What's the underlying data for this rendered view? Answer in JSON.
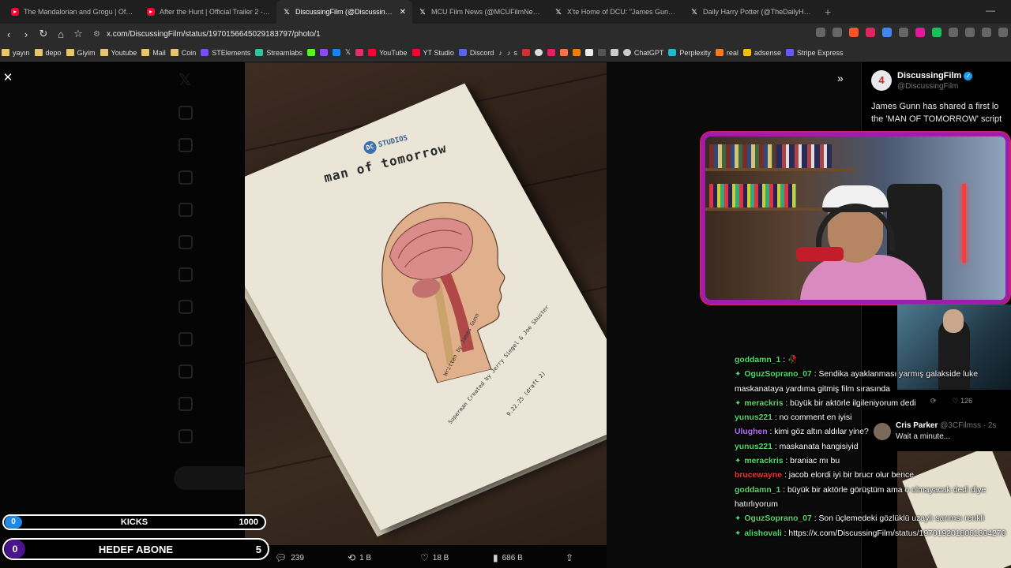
{
  "browser": {
    "tabs": [
      {
        "favicon": "youtube-icon",
        "label": "The Mandalorian and Grogu | Officia",
        "active": false
      },
      {
        "favicon": "youtube-icon",
        "label": "After the Hunt | Official Trailer 2 - Yo",
        "active": false
      },
      {
        "favicon": "x-icon",
        "label": "DiscussingFilm (@DiscussingFilm",
        "active": true
      },
      {
        "favicon": "x-icon",
        "label": "MCU Film News (@MCUFilmNews) /",
        "active": false
      },
      {
        "favicon": "x-icon",
        "label": "X'te Home of DCU: \"James Gunn say",
        "active": false
      },
      {
        "favicon": "x-icon",
        "label": "Daily Harry Potter (@TheDailyHPotte",
        "active": false
      }
    ],
    "url": "x.com/DiscussingFilm/status/1970156645029183797/photo/1",
    "bookmarks": [
      {
        "label": "yayın",
        "type": "folder"
      },
      {
        "label": "depo",
        "type": "folder"
      },
      {
        "label": "Giyim",
        "type": "folder"
      },
      {
        "label": "Youtube",
        "type": "folder"
      },
      {
        "label": "Mail",
        "type": "folder"
      },
      {
        "label": "Coin",
        "type": "folder"
      },
      {
        "label": "STElements",
        "type": "site",
        "color": "#7b4dff"
      },
      {
        "label": "Streamlabs",
        "type": "site",
        "color": "#31c3a2"
      },
      {
        "label": "YouTube",
        "type": "site",
        "color": "#ff0033"
      },
      {
        "label": "YT Studio",
        "type": "site",
        "color": "#ff0033"
      },
      {
        "label": "Discord",
        "type": "site",
        "color": "#5865f2"
      },
      {
        "label": "s",
        "type": "site",
        "color": "#222222"
      },
      {
        "label": "ChatGPT",
        "type": "site",
        "color": "#cccccc"
      },
      {
        "label": "Perplexity",
        "type": "site",
        "color": "#20b8cd"
      },
      {
        "label": "real",
        "type": "site",
        "color": "#ff7a1a"
      },
      {
        "label": "adsense",
        "type": "site",
        "color": "#fbbc04"
      },
      {
        "label": "Stripe Express",
        "type": "site",
        "color": "#635bff"
      }
    ]
  },
  "photo": {
    "studio_label": "STUDIOS",
    "title": "man of tomorrow",
    "credits": [
      "Written by James Gunn",
      "Superman Created by Jerry Siegel & Joe Shuster",
      "9.22.25 (draft 2)"
    ]
  },
  "tweet": {
    "author_name": "DiscussingFilm",
    "author_handle": "@DiscussingFilm",
    "text_line1": "James Gunn has shared a first lo",
    "text_line2": "the 'MAN OF TOMORROW' script"
  },
  "actions": {
    "replies": "239",
    "reposts": "1 B",
    "likes": "18 B",
    "views": "686 B"
  },
  "reply": {
    "name": "Cris Parker",
    "handle": "@3CFilmss · 2s",
    "text": "Wait a minute...",
    "stats_reply": "126"
  },
  "chat": [
    {
      "user": "goddamn_1",
      "color": "#53d769",
      "badge": false,
      "text": " : 🥀"
    },
    {
      "user": "OguzSoprano_07",
      "color": "#53d769",
      "badge": true,
      "text": " : Sendika ayaklanması yarmış galakside luke maskanataya yardıma gitmiş film sırasında"
    },
    {
      "user": "merackris",
      "color": "#53d769",
      "badge": true,
      "text": " : büyük bir aktörle ilgileniyorum dedi"
    },
    {
      "user": "yunus221",
      "color": "#53d769",
      "badge": false,
      "text": " : no comment en iyisi"
    },
    {
      "user": "Ulughen",
      "color": "#b36bff",
      "badge": false,
      "text": " : kimi göz altın aldılar yine?"
    },
    {
      "user": "yunus221",
      "color": "#53d769",
      "badge": false,
      "text": " : maskanata hangisiyid"
    },
    {
      "user": "merackris",
      "color": "#53d769",
      "badge": true,
      "text": " : braniac mı bu"
    },
    {
      "user": "brucewayne",
      "color": "#e53935",
      "badge": false,
      "text": " : jacob elordi iyi bir brucr olur bence"
    },
    {
      "user": "goddamn_1",
      "color": "#53d769",
      "badge": false,
      "text": " : büyük bir aktörle görüştüm ama o olmayacak dedi diye hatırlıyorum"
    },
    {
      "user": "OguzSoprano_07",
      "color": "#53d769",
      "badge": true,
      "text": " : Son üçlemedeki gözlüklü uzaylı sarımsı renkli"
    },
    {
      "user": "alishovali",
      "color": "#53d769",
      "badge": true,
      "text": " : https://x.com/DiscussingFilm/status/1970192018061304270"
    }
  ],
  "overlay": {
    "kicks": {
      "count": "0",
      "label": "KICKS",
      "goal": "1000"
    },
    "abone": {
      "count": "0",
      "label": "HEDEF ABONE",
      "goal": "5"
    }
  },
  "colors": {
    "accent": "#1d9bf0",
    "webcam_border": "#9b1fa8",
    "chat_green": "#53d769"
  }
}
